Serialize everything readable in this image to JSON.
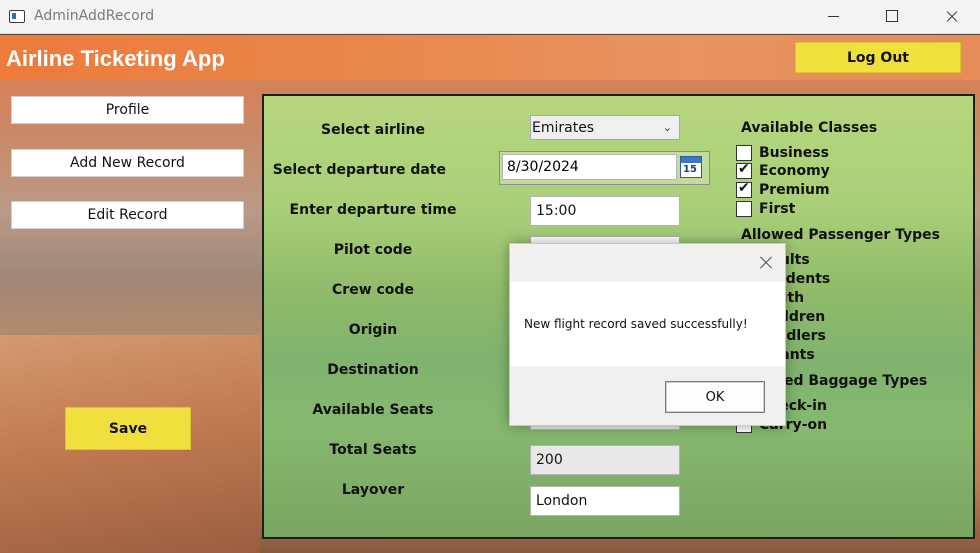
{
  "window": {
    "title": "AdminAddRecord"
  },
  "header": {
    "app_title": "Airline Ticketing App",
    "logout_label": "Log Out"
  },
  "sidebar": {
    "items": [
      {
        "label": "Profile"
      },
      {
        "label": "Add New Record"
      },
      {
        "label": "Edit Record"
      }
    ],
    "save_label": "Save"
  },
  "form": {
    "labels": {
      "airline": "Select airline",
      "departure_date": "Select departure date",
      "departure_time": "Enter departure time",
      "pilot": "Pilot code",
      "crew": "Crew code",
      "origin": "Origin",
      "destination": "Destination",
      "available_seats": "Available Seats",
      "total_seats": "Total Seats",
      "layover": "Layover"
    },
    "airline_value": "Emirates",
    "departure_date_value": "8/30/2024",
    "calendar_day": "15",
    "departure_time_value": "15:00",
    "total_seats_value": "200",
    "layover_value": "London"
  },
  "classes": {
    "heading": "Available Classes",
    "items": [
      {
        "label": "Business",
        "checked": false
      },
      {
        "label": "Economy",
        "checked": true
      },
      {
        "label": "Premium",
        "checked": true
      },
      {
        "label": "First",
        "checked": false
      }
    ]
  },
  "passenger_types": {
    "heading": "Allowed Passenger Types",
    "items": [
      "Adults",
      "Students",
      "Youth",
      "Children",
      "Toddlers",
      "Infants"
    ]
  },
  "baggage_types": {
    "heading": "Allowed Baggage Types",
    "items": [
      "Check-in",
      "Carry-on"
    ]
  },
  "dialog": {
    "message": "New flight record saved successfully!",
    "ok_label": "OK"
  }
}
